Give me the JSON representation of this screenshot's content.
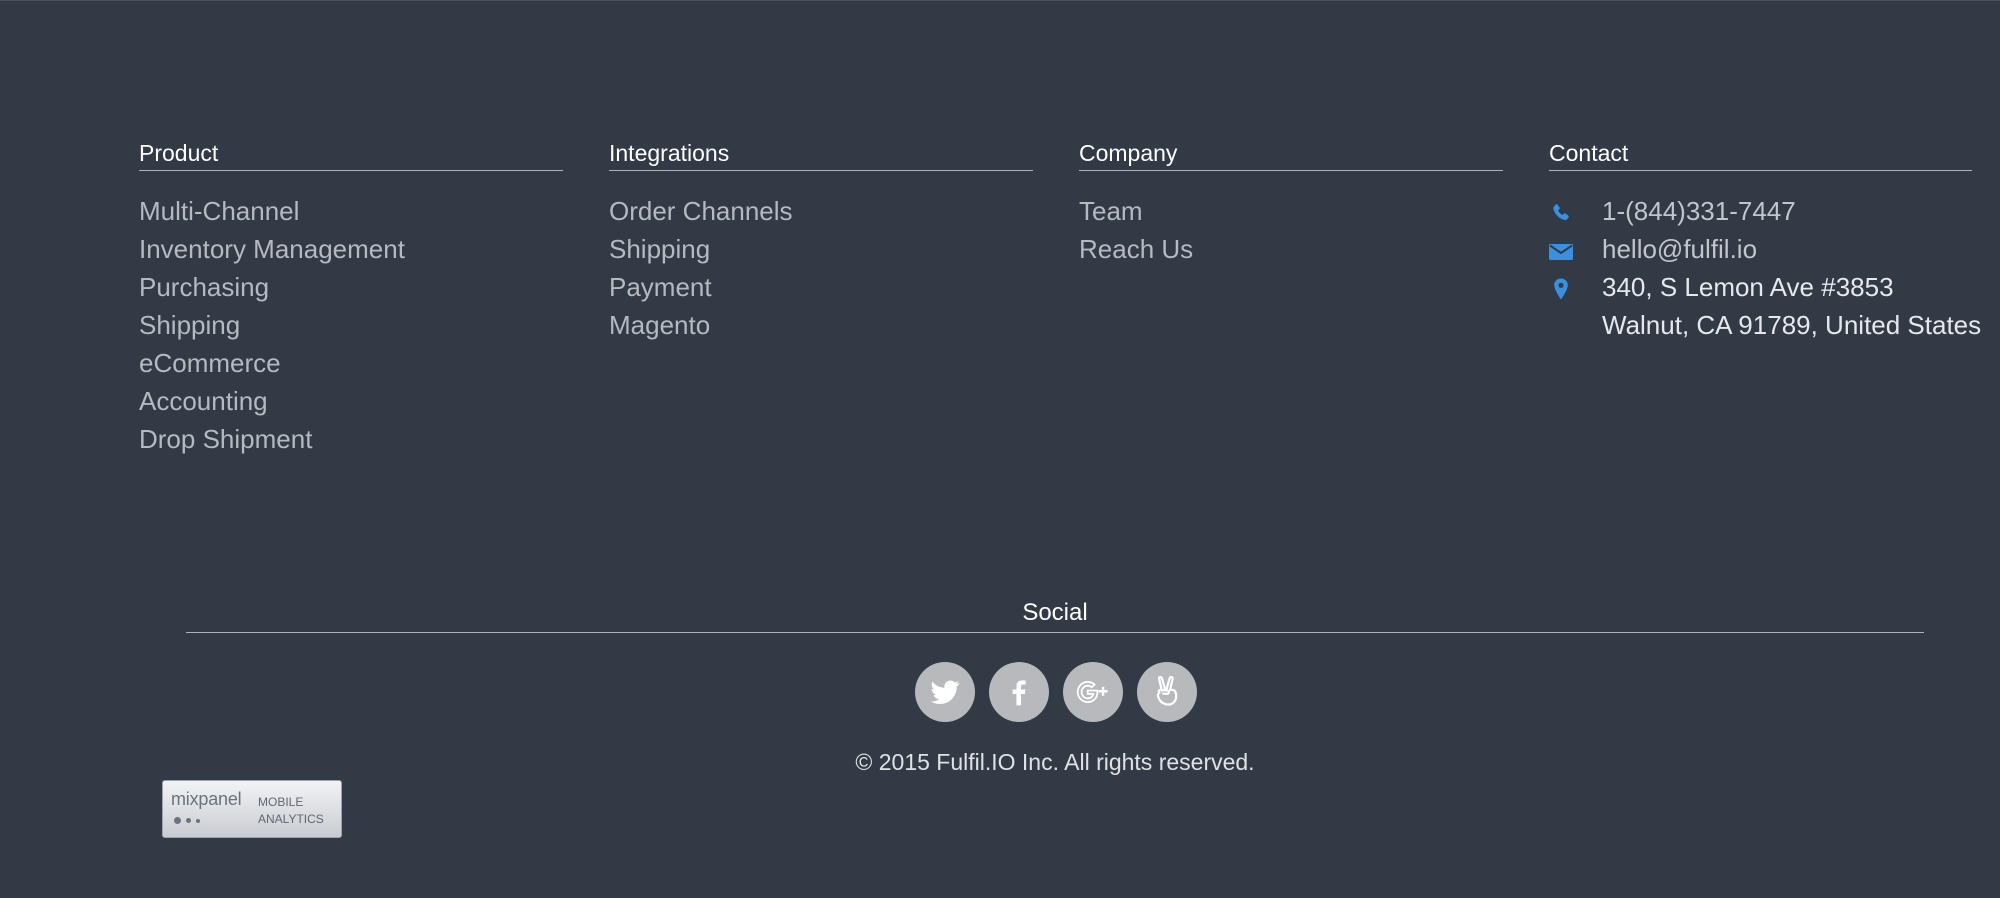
{
  "columns": {
    "product": {
      "title": "Product",
      "items": [
        "Multi-Channel",
        "Inventory Management",
        "Purchasing",
        "Shipping",
        "eCommerce",
        "Accounting",
        "Drop Shipment"
      ]
    },
    "integrations": {
      "title": "Integrations",
      "items": [
        "Order Channels",
        "Shipping",
        "Payment",
        "Magento"
      ]
    },
    "company": {
      "title": "Company",
      "items": [
        "Team",
        "Reach Us"
      ]
    },
    "contact": {
      "title": "Contact",
      "phone": "1-(844)331-7447",
      "email": "hello@fulfil.io",
      "address_line1": "340, S Lemon Ave #3853",
      "address_line2": "Walnut, CA 91789, United States"
    }
  },
  "social": {
    "title": "Social",
    "icons": [
      "twitter-icon",
      "facebook-icon",
      "google-plus-icon",
      "angellist-icon"
    ]
  },
  "copyright": "© 2015 Fulfil.IO Inc. All rights reserved.",
  "badge": {
    "brand": "mixpanel",
    "line1": "MOBILE",
    "line2": "ANALYTICS"
  },
  "colors": {
    "background": "#323a46",
    "accent_icon": "#3b8fe0"
  }
}
